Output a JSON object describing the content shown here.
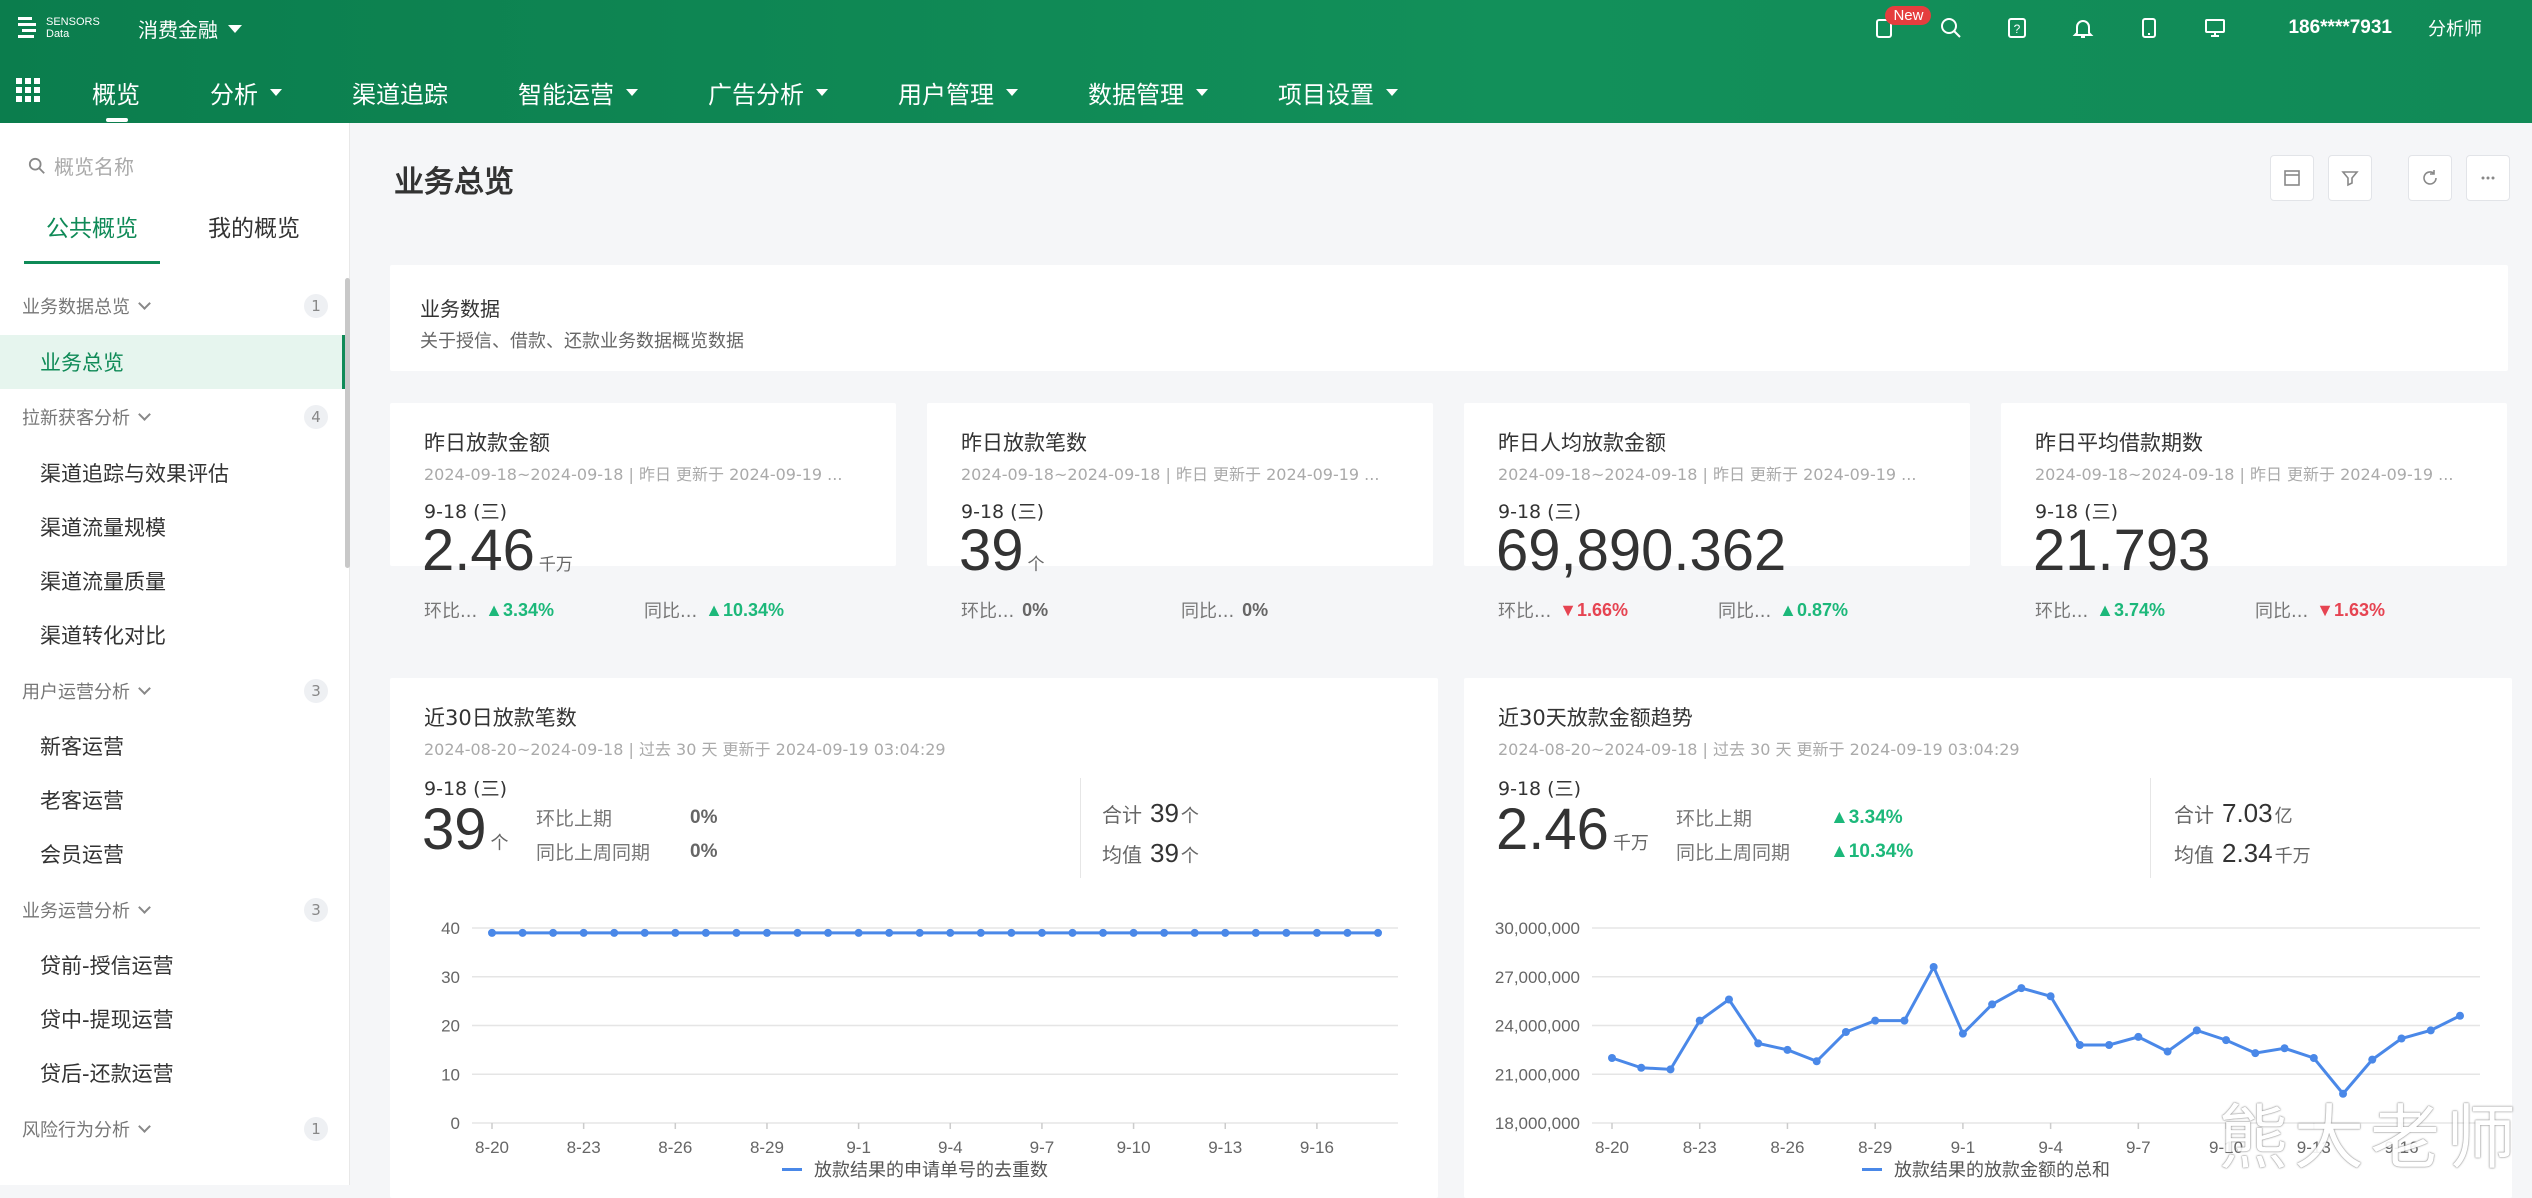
{
  "header": {
    "logo_text_line1": "SENSORS",
    "logo_text_line2": "Data",
    "project": "消费金融",
    "new_badge": "New",
    "user": "186****7931",
    "role": "分析师"
  },
  "nav": {
    "items": [
      {
        "label": "概览",
        "dropdown": false,
        "active": true
      },
      {
        "label": "分析",
        "dropdown": true
      },
      {
        "label": "渠道追踪",
        "dropdown": false
      },
      {
        "label": "智能运营",
        "dropdown": true
      },
      {
        "label": "广告分析",
        "dropdown": true
      },
      {
        "label": "用户管理",
        "dropdown": true
      },
      {
        "label": "数据管理",
        "dropdown": true
      },
      {
        "label": "项目设置",
        "dropdown": true
      }
    ]
  },
  "sidebar": {
    "search_placeholder": "概览名称",
    "tabs": [
      "公共概览",
      "我的概览"
    ],
    "groups": [
      {
        "label": "业务数据总览",
        "count": "1",
        "items": [
          "业务总览"
        ]
      },
      {
        "label": "拉新获客分析",
        "count": "4",
        "items": [
          "渠道追踪与效果评估",
          "渠道流量规模",
          "渠道流量质量",
          "渠道转化对比"
        ]
      },
      {
        "label": "用户运营分析",
        "count": "3",
        "items": [
          "新客运营",
          "老客运营",
          "会员运营"
        ]
      },
      {
        "label": "业务运营分析",
        "count": "3",
        "items": [
          "贷前-授信运营",
          "贷中-提现运营",
          "贷后-还款运营"
        ]
      },
      {
        "label": "风险行为分析",
        "count": "1",
        "items": []
      }
    ]
  },
  "page": {
    "title": "业务总览",
    "biz": {
      "title": "业务数据",
      "desc": "关于授信、借款、还款业务数据概览数据"
    }
  },
  "kpis": [
    {
      "title": "昨日放款金额",
      "meta": "2024-09-18~2024-09-18  | 昨日 更新于 2024-09-19 ...",
      "date": "9-18 (三)",
      "value": "2.46",
      "unit": "千万",
      "mom_label": "环比...",
      "mom": "▲3.34%",
      "mom_dir": "up",
      "yoy_label": "同比...",
      "yoy": "▲10.34%",
      "yoy_dir": "up"
    },
    {
      "title": "昨日放款笔数",
      "meta": "2024-09-18~2024-09-18  | 昨日 更新于 2024-09-19 ...",
      "date": "9-18 (三)",
      "value": "39",
      "unit": "个",
      "mom_label": "环比...",
      "mom": "0%",
      "mom_dir": "flat",
      "yoy_label": "同比...",
      "yoy": "0%",
      "yoy_dir": "flat"
    },
    {
      "title": "昨日人均放款金额",
      "meta": "2024-09-18~2024-09-18  | 昨日 更新于 2024-09-19 ...",
      "date": "9-18 (三)",
      "value": "69,890.362",
      "unit": "",
      "mom_label": "环比...",
      "mom": "▼1.66%",
      "mom_dir": "down",
      "yoy_label": "同比...",
      "yoy": "▲0.87%",
      "yoy_dir": "up"
    },
    {
      "title": "昨日平均借款期数",
      "meta": "2024-09-18~2024-09-18  | 昨日 更新于 2024-09-19 ...",
      "date": "9-18 (三)",
      "value": "21.793",
      "unit": "",
      "mom_label": "环比...",
      "mom": "▲3.74%",
      "mom_dir": "up",
      "yoy_label": "同比...",
      "yoy": "▼1.63%",
      "yoy_dir": "down"
    }
  ],
  "charts": [
    {
      "title": "近30日放款笔数",
      "meta": "2024-08-20~2024-09-18  | 过去 30 天 更新于 2024-09-19 03:04:29",
      "date": "9-18 (三)",
      "value": "39",
      "unit": "个",
      "mom_label": "环比上期",
      "mom": "0%",
      "mom_dir": "flat",
      "yoy_label": "同比上周同期",
      "yoy": "0%",
      "yoy_dir": "flat",
      "sum_label": "合计",
      "sum": "39",
      "sum_unit": "个",
      "avg_label": "均值",
      "avg": "39",
      "avg_unit": "个",
      "legend": "放款结果的申请单号的去重数"
    },
    {
      "title": "近30天放款金额趋势",
      "meta": "2024-08-20~2024-09-18  | 过去 30 天 更新于 2024-09-19 03:04:29",
      "date": "9-18 (三)",
      "value": "2.46",
      "unit": "千万",
      "mom_label": "环比上期",
      "mom": "▲3.34%",
      "mom_dir": "up",
      "yoy_label": "同比上周同期",
      "yoy": "▲10.34%",
      "yoy_dir": "up",
      "sum_label": "合计",
      "sum": "7.03",
      "sum_unit": "亿",
      "avg_label": "均值",
      "avg": "2.34",
      "avg_unit": "千万",
      "legend": "放款结果的放款金额的总和"
    }
  ],
  "chart_data": [
    {
      "type": "line",
      "title": "近30日放款笔数",
      "x": [
        "8-20",
        "8-21",
        "8-22",
        "8-23",
        "8-24",
        "8-25",
        "8-26",
        "8-27",
        "8-28",
        "8-29",
        "8-30",
        "8-31",
        "9-1",
        "9-2",
        "9-3",
        "9-4",
        "9-5",
        "9-6",
        "9-7",
        "9-8",
        "9-9",
        "9-10",
        "9-11",
        "9-12",
        "9-13",
        "9-14",
        "9-15",
        "9-16",
        "9-17",
        "9-18"
      ],
      "x_ticks": [
        "8-20",
        "8-23",
        "8-26",
        "8-29",
        "9-1",
        "9-4",
        "9-7",
        "9-10",
        "9-13",
        "9-16"
      ],
      "series": [
        {
          "name": "放款结果的申请单号的去重数",
          "values": [
            39,
            39,
            39,
            39,
            39,
            39,
            39,
            39,
            39,
            39,
            39,
            39,
            39,
            39,
            39,
            39,
            39,
            39,
            39,
            39,
            39,
            39,
            39,
            39,
            39,
            39,
            39,
            39,
            39,
            39
          ]
        }
      ],
      "ylim": [
        0,
        40
      ],
      "y_ticks": [
        0,
        10,
        20,
        30,
        40
      ],
      "grid": true,
      "legend": "bottom",
      "color": "#4a88e8"
    },
    {
      "type": "line",
      "title": "近30天放款金额趋势",
      "x": [
        "8-20",
        "8-21",
        "8-22",
        "8-23",
        "8-24",
        "8-25",
        "8-26",
        "8-27",
        "8-28",
        "8-29",
        "8-30",
        "8-31",
        "9-1",
        "9-2",
        "9-3",
        "9-4",
        "9-5",
        "9-6",
        "9-7",
        "9-8",
        "9-9",
        "9-10",
        "9-11",
        "9-12",
        "9-13",
        "9-14",
        "9-15",
        "9-16",
        "9-17",
        "9-18"
      ],
      "x_ticks": [
        "8-20",
        "8-23",
        "8-26",
        "8-29",
        "9-1",
        "9-4",
        "9-7",
        "9-10",
        "9-13",
        "9-16"
      ],
      "series": [
        {
          "name": "放款结果的放款金额的总和",
          "values": [
            22000000,
            21400000,
            21300000,
            24300000,
            25600000,
            22900000,
            22500000,
            21800000,
            23600000,
            24300000,
            24300000,
            27600000,
            23500000,
            25300000,
            26300000,
            25800000,
            22800000,
            22800000,
            23300000,
            22400000,
            23700000,
            23100000,
            22300000,
            22600000,
            22000000,
            19800000,
            21900000,
            23200000,
            23700000,
            24600000
          ]
        }
      ],
      "ylim": [
        18000000,
        30000000
      ],
      "y_ticks": [
        "18,000,000",
        "21,000,000",
        "24,000,000",
        "27,000,000",
        "30,000,000"
      ],
      "grid": true,
      "legend": "bottom",
      "color": "#4a88e8"
    }
  ],
  "watermark": "熊大老师"
}
